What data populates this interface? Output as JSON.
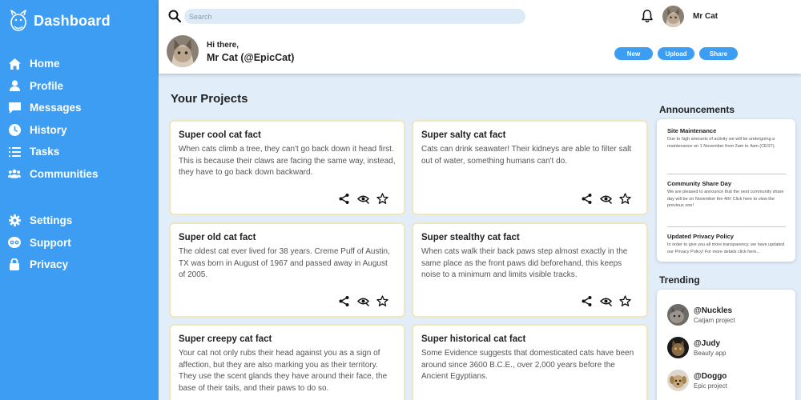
{
  "brand": {
    "title": "Dashboard"
  },
  "nav": {
    "main": [
      {
        "label": "Home",
        "icon": "home-icon"
      },
      {
        "label": "Profile",
        "icon": "user-icon"
      },
      {
        "label": "Messages",
        "icon": "chat-icon"
      },
      {
        "label": "History",
        "icon": "clock-icon"
      },
      {
        "label": "Tasks",
        "icon": "list-icon"
      },
      {
        "label": "Communities",
        "icon": "group-icon"
      }
    ],
    "secondary": [
      {
        "label": "Settings",
        "icon": "gear-icon"
      },
      {
        "label": "Support",
        "icon": "support-icon"
      },
      {
        "label": "Privacy",
        "icon": "lock-icon"
      }
    ]
  },
  "header": {
    "search_placeholder": "Search",
    "user_name": "Mr Cat",
    "greeting": "Hi there,",
    "full_name": "Mr Cat (@EpicCat)",
    "buttons": {
      "new": "New",
      "upload": "Upload",
      "share": "Share"
    }
  },
  "projects": {
    "title": "Your Projects",
    "cards": [
      {
        "title": "Super cool cat fact",
        "text": "When cats climb a tree, they can't go back down it head first. This is because their claws are facing the same way, instead, they have to go back down backward."
      },
      {
        "title": "Super salty cat fact",
        "text": "Cats can drink seawater! Their kidneys are able to filter salt out of water, something humans can't do."
      },
      {
        "title": "Super old cat fact",
        "text": "The oldest cat ever lived for 38 years. Creme Puff of Austin, TX was born in August of 1967 and passed away in August of 2005."
      },
      {
        "title": "Super stealthy cat fact",
        "text": "When cats walk their back paws step almost exactly in the same place as the front paws did beforehand, this keeps noise to a minimum and limits visible tracks."
      },
      {
        "title": "Super creepy cat fact",
        "text": "Your cat not only rubs their head against you as a sign of affection, but they are also marking you as their territory. They use the scent glands they have around their face, the base of their tails, and their paws to do so."
      },
      {
        "title": "Super historical cat fact",
        "text": "Some Evidence suggests that domesticated cats have been around since 3600 B.C.E., over 2,000 years before the Ancient Egyptians."
      }
    ]
  },
  "announcements": {
    "title": "Announcements",
    "items": [
      {
        "title": "Site Maintenance",
        "body": "Due to high amounts of activity we will be undergoing a maintenance on 1 November from 2am to 4am (CEST)."
      },
      {
        "title": "Community Share Day",
        "body": "We are pleased to announce that the next community share day will be on November the 4th! Click here to view the previous one!"
      },
      {
        "title": "Updated Privacy Policy",
        "body": "In order to give you all more transparency, we have updated our Privacy Policy! For more details click here..."
      }
    ]
  },
  "trending": {
    "title": "Trending",
    "items": [
      {
        "name": "@Nuckles",
        "project": "Catjam project"
      },
      {
        "name": "@Judy",
        "project": "Beauty app"
      },
      {
        "name": "@Doggo",
        "project": "Epic project"
      }
    ]
  },
  "colors": {
    "accent": "#3d9df2",
    "background": "#e1eefa",
    "card_border": "#f2e5be"
  }
}
